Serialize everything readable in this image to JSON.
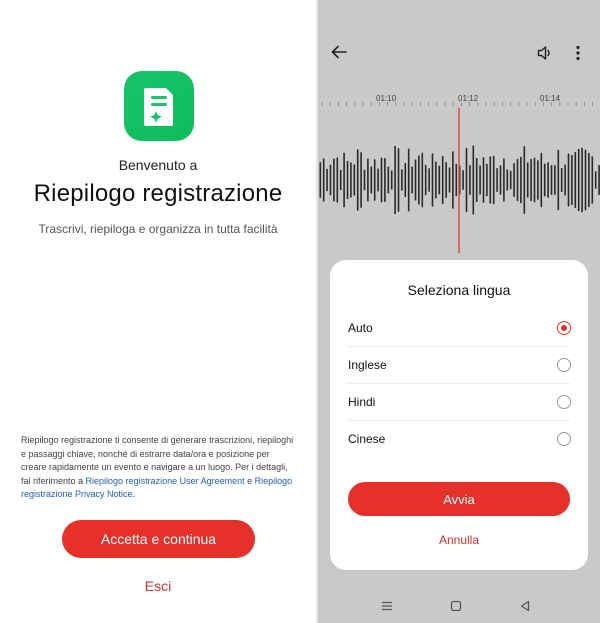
{
  "left": {
    "welcome": "Benvenuto a",
    "app_title": "Riepilogo registrazione",
    "subtitle": "Trascrivi, riepiloga e organizza in tutta facilità",
    "legal": {
      "text": "Riepilogo registrazione ti consente di generare trascrizioni, riepiloghi e passaggi chiave, nonché di estrarre data/ora e posizione per creare rapidamente un evento e navigare a un luogo. Per i dettagli, fai riferimento a ",
      "link_agreement": "Riepilogo registrazione User Agreement",
      "conjunction": " e ",
      "link_privacy": "Riepilogo registrazione Privacy Notice",
      "end": "."
    },
    "accept_label": "Accetta e continua",
    "exit_label": "Esci"
  },
  "right": {
    "timeline": [
      "01:10",
      "01:12",
      "01:14"
    ],
    "sheet": {
      "title": "Seleziona lingua",
      "options": [
        {
          "label": "Auto",
          "selected": true
        },
        {
          "label": "Inglese",
          "selected": false
        },
        {
          "label": "Hindi",
          "selected": false
        },
        {
          "label": "Cinese",
          "selected": false
        }
      ],
      "start_label": "Avvia",
      "cancel_label": "Annulla"
    }
  },
  "colors": {
    "accent": "#e5312a",
    "app_icon": "#19c46a",
    "link": "#1f5fb8"
  },
  "icons": [
    "app-note-icon",
    "back-arrow-icon",
    "volume-icon",
    "more-vertical-icon",
    "nav-menu-icon",
    "nav-home-icon",
    "nav-back-icon"
  ]
}
